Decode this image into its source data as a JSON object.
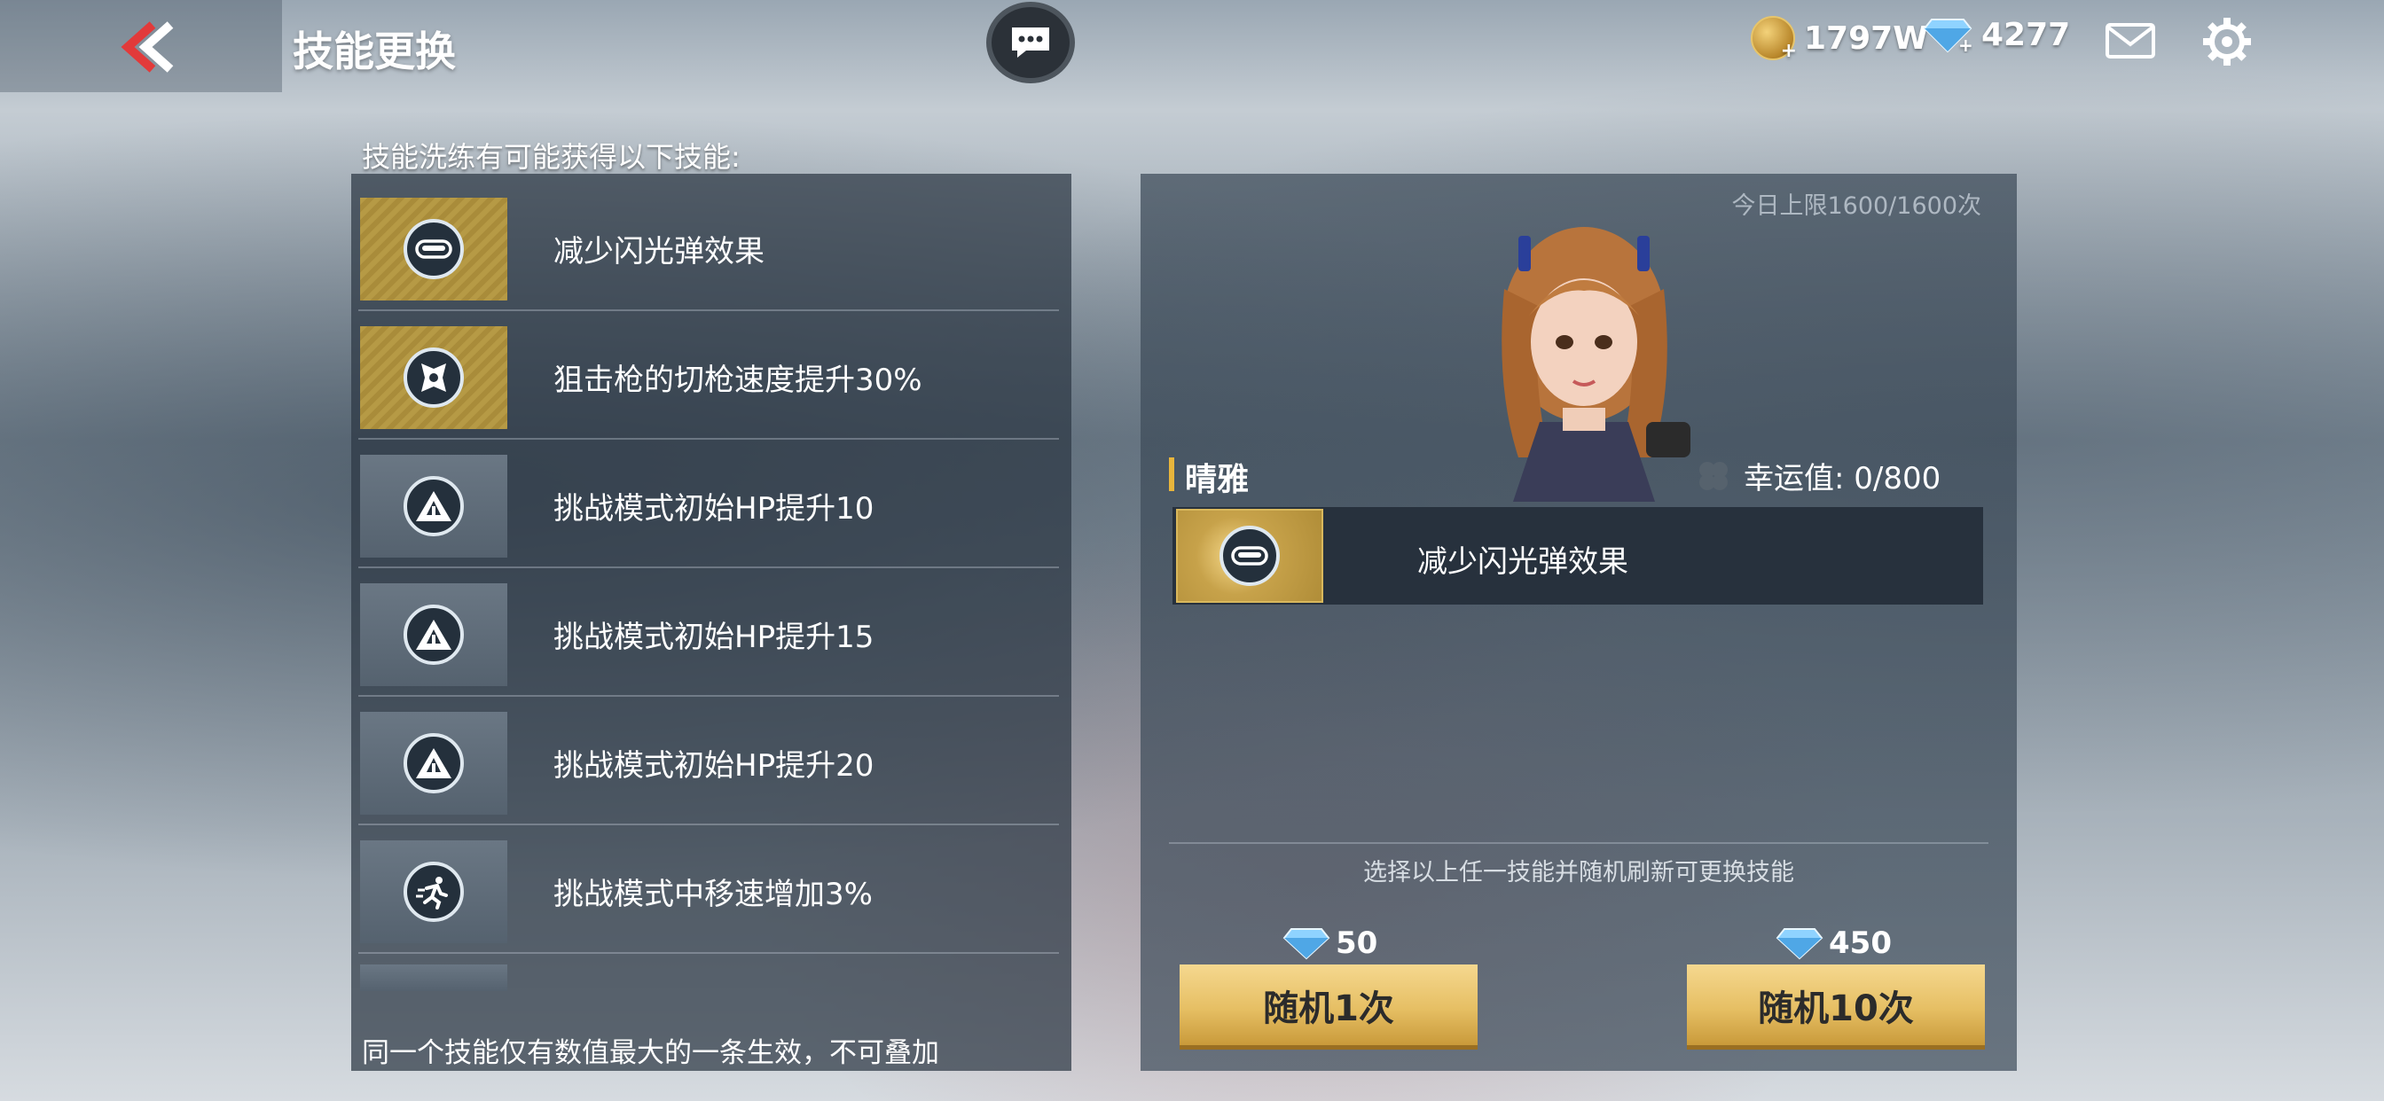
{
  "header": {
    "title": "技能更换",
    "gold": "1797W",
    "diamonds": "4277",
    "icons": {
      "back": "back-chevron-icon",
      "chat": "chat-bubble-icon",
      "mail": "mail-icon",
      "settings": "gear-icon"
    }
  },
  "left": {
    "caption": "技能洗练有可能获得以下技能:",
    "note": "同一个技能仅有数值最大的一条生效，不可叠加",
    "skills": [
      {
        "label": "减少闪光弹效果",
        "tier": "gold",
        "icon": "goggles-icon"
      },
      {
        "label": "狙击枪的切枪速度提升30%",
        "tier": "gold",
        "icon": "sniper-emblem-icon"
      },
      {
        "label": "挑战模式初始HP提升10",
        "tier": "gray",
        "icon": "triangle-emblem-icon"
      },
      {
        "label": "挑战模式初始HP提升15",
        "tier": "gray",
        "icon": "triangle-emblem-icon"
      },
      {
        "label": "挑战模式初始HP提升20",
        "tier": "gray",
        "icon": "triangle-emblem-icon"
      },
      {
        "label": "挑战模式中移速增加3%",
        "tier": "gray",
        "icon": "running-icon"
      }
    ]
  },
  "right": {
    "daily_limit": "今日上限1600/1600次",
    "character_name": "晴雅",
    "luck_label": "幸运值: 0/800",
    "current_skill": "减少闪光弹效果",
    "hint": "选择以上任一技能并随机刷新可更换技能",
    "buttons": [
      {
        "label": "随机1次",
        "cost": "50"
      },
      {
        "label": "随机10次",
        "cost": "450"
      }
    ]
  },
  "colors": {
    "gold_accent": "#e8b53c",
    "panel": "#2c3844"
  }
}
